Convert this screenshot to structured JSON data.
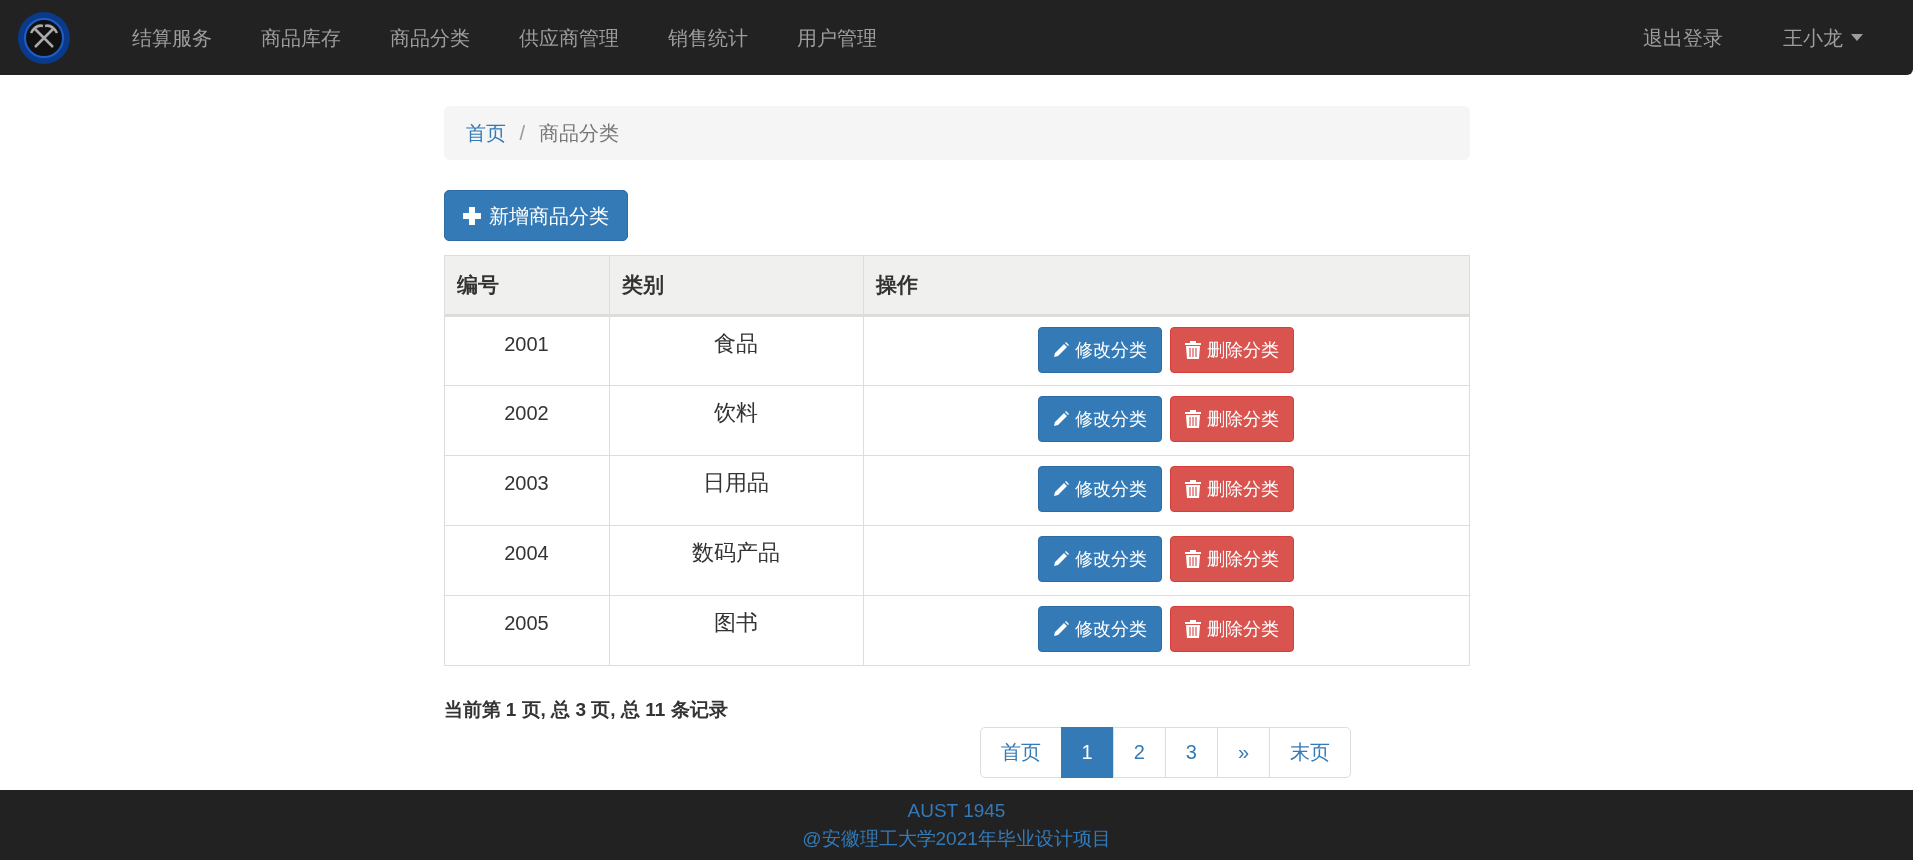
{
  "navbar": {
    "items": [
      "结算服务",
      "商品库存",
      "商品分类",
      "供应商管理",
      "销售统计",
      "用户管理"
    ],
    "logout": "退出登录",
    "user": "王小龙"
  },
  "breadcrumb": {
    "home": "首页",
    "separator": "/",
    "current": "商品分类"
  },
  "add_button": "新增商品分类",
  "table": {
    "columns": [
      "编号",
      "类别",
      "操作"
    ],
    "rows": [
      {
        "id": "2001",
        "category": "食品",
        "edit": "修改分类",
        "delete": "删除分类"
      },
      {
        "id": "2002",
        "category": "饮料",
        "edit": "修改分类",
        "delete": "删除分类"
      },
      {
        "id": "2003",
        "category": "日用品",
        "edit": "修改分类",
        "delete": "删除分类"
      },
      {
        "id": "2004",
        "category": "数码产品",
        "edit": "修改分类",
        "delete": "删除分类"
      },
      {
        "id": "2005",
        "category": "图书",
        "edit": "修改分类",
        "delete": "删除分类"
      }
    ]
  },
  "page_info": "当前第 1 页, 总 3 页, 总 11 条记录",
  "pagination": [
    {
      "label": "首页",
      "selected": false
    },
    {
      "label": "1",
      "selected": true
    },
    {
      "label": "2",
      "selected": false
    },
    {
      "label": "3",
      "selected": false
    },
    {
      "label": "»",
      "selected": false
    },
    {
      "label": "末页",
      "selected": false
    }
  ],
  "footer": [
    "AUST 1945",
    "@安徽理工大学2021年毕业设计项目"
  ]
}
